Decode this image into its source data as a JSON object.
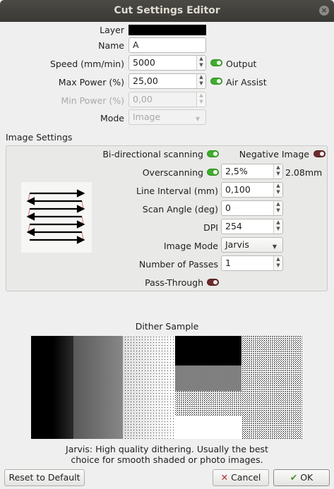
{
  "window": {
    "title": "Cut Settings Editor",
    "close_glyph": "×"
  },
  "main": {
    "layer_label": "Layer",
    "layer_color": "#000000",
    "name_label": "Name",
    "name_value": "A",
    "speed_label": "Speed (mm/min)",
    "speed_value": "5000",
    "output_label": "Output",
    "output_on": true,
    "max_power_label": "Max Power (%)",
    "max_power_value": "25,00",
    "air_assist_label": "Air Assist",
    "air_assist_on": true,
    "min_power_label": "Min Power (%)",
    "min_power_value": "0,00",
    "mode_label": "Mode",
    "mode_value": "Image"
  },
  "image_settings": {
    "group_title": "Image Settings",
    "bidir_label": "Bi-directional scanning",
    "bidir_on": true,
    "negative_label": "Negative Image",
    "negative_on": false,
    "overscan_label": "Overscanning",
    "overscan_on": true,
    "overscan_value": "2,5%",
    "overscan_mm": "2.08mm",
    "line_interval_label": "Line Interval (mm)",
    "line_interval_value": "0,100",
    "scan_angle_label": "Scan Angle (deg)",
    "scan_angle_value": "0",
    "dpi_label": "DPI",
    "dpi_value": "254",
    "image_mode_label": "Image Mode",
    "image_mode_value": "Jarvis",
    "passes_label": "Number of Passes",
    "passes_value": "1",
    "pass_through_label": "Pass-Through",
    "pass_through_on": false
  },
  "dither": {
    "title": "Dither Sample",
    "description_line1": "Jarvis: High quality dithering. Usually the best",
    "description_line2": "choice for smooth shaded or photo images."
  },
  "footer": {
    "reset_label": "Reset to Default",
    "cancel_label": "Cancel",
    "ok_label": "OK"
  },
  "colors": {
    "toggle_on": "#3dae2b",
    "toggle_off": "#6e2b2b",
    "titlebar": "#3c3b37"
  }
}
